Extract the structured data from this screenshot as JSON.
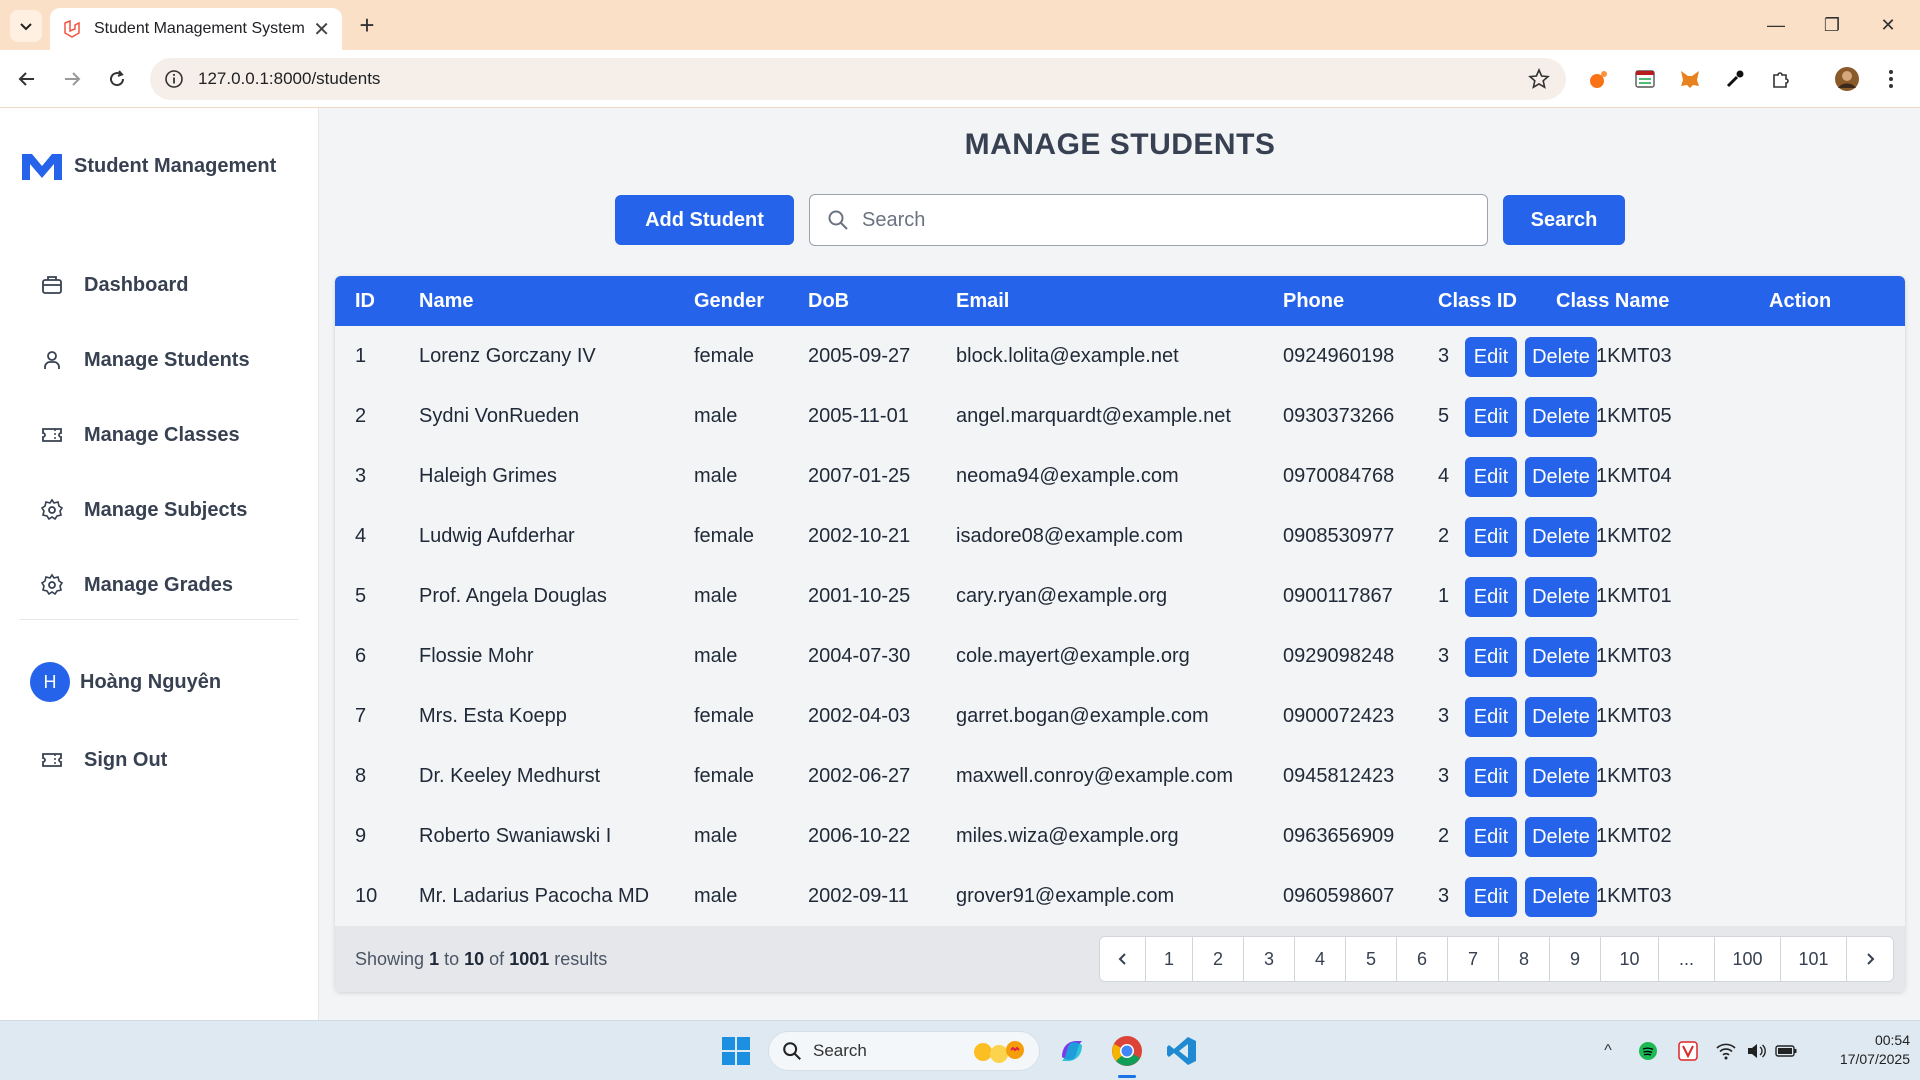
{
  "browser": {
    "tab_title": "Student Management System",
    "url": "127.0.0.1:8000/students"
  },
  "sidebar": {
    "brand": "Student Management",
    "items": [
      {
        "label": "Dashboard",
        "icon": "briefcase-icon"
      },
      {
        "label": "Manage Students",
        "icon": "user-icon"
      },
      {
        "label": "Manage Classes",
        "icon": "ticket-icon"
      },
      {
        "label": "Manage Subjects",
        "icon": "gear-icon"
      },
      {
        "label": "Manage Grades",
        "icon": "gear-icon"
      }
    ],
    "user": {
      "initial": "H",
      "name": "Hoàng Nguyên"
    },
    "sign_out": "Sign Out"
  },
  "main": {
    "title": "MANAGE STUDENTS",
    "add_label": "Add Student",
    "search_placeholder": "Search",
    "search_label": "Search"
  },
  "table": {
    "headers": [
      "ID",
      "Name",
      "Gender",
      "DoB",
      "Email",
      "Phone",
      "Class ID",
      "Class Name",
      "Action"
    ],
    "rows": [
      {
        "id": "1",
        "name": "Lorenz Gorczany IV",
        "gender": "female",
        "dob": "2005-09-27",
        "email": "block.lolita@example.net",
        "phone": "0924960198",
        "class_id": "3",
        "class_name": "DH21KMT03"
      },
      {
        "id": "2",
        "name": "Sydni VonRueden",
        "gender": "male",
        "dob": "2005-11-01",
        "email": "angel.marquardt@example.net",
        "phone": "0930373266",
        "class_id": "5",
        "class_name": "DH21KMT05"
      },
      {
        "id": "3",
        "name": "Haleigh Grimes",
        "gender": "male",
        "dob": "2007-01-25",
        "email": "neoma94@example.com",
        "phone": "0970084768",
        "class_id": "4",
        "class_name": "DH21KMT04"
      },
      {
        "id": "4",
        "name": "Ludwig Aufderhar",
        "gender": "female",
        "dob": "2002-10-21",
        "email": "isadore08@example.com",
        "phone": "0908530977",
        "class_id": "2",
        "class_name": "DH21KMT02"
      },
      {
        "id": "5",
        "name": "Prof. Angela Douglas",
        "gender": "male",
        "dob": "2001-10-25",
        "email": "cary.ryan@example.org",
        "phone": "0900117867",
        "class_id": "1",
        "class_name": "DH21KMT01"
      },
      {
        "id": "6",
        "name": "Flossie Mohr",
        "gender": "male",
        "dob": "2004-07-30",
        "email": "cole.mayert@example.org",
        "phone": "0929098248",
        "class_id": "3",
        "class_name": "DH21KMT03"
      },
      {
        "id": "7",
        "name": "Mrs. Esta Koepp",
        "gender": "female",
        "dob": "2002-04-03",
        "email": "garret.bogan@example.com",
        "phone": "0900072423",
        "class_id": "3",
        "class_name": "DH21KMT03"
      },
      {
        "id": "8",
        "name": "Dr. Keeley Medhurst",
        "gender": "female",
        "dob": "2002-06-27",
        "email": "maxwell.conroy@example.com",
        "phone": "0945812423",
        "class_id": "3",
        "class_name": "DH21KMT03"
      },
      {
        "id": "9",
        "name": "Roberto Swaniawski I",
        "gender": "male",
        "dob": "2006-10-22",
        "email": "miles.wiza@example.org",
        "phone": "0963656909",
        "class_id": "2",
        "class_name": "DH21KMT02"
      },
      {
        "id": "10",
        "name": "Mr. Ladarius Pacocha MD",
        "gender": "male",
        "dob": "2002-09-11",
        "email": "grover91@example.com",
        "phone": "0960598607",
        "class_id": "3",
        "class_name": "DH21KMT03"
      }
    ],
    "edit_label": "Edit",
    "delete_label": "Delete"
  },
  "pagination": {
    "showing_prefix": "Showing",
    "from": "1",
    "to_word": "to",
    "to": "10",
    "of_word": "of",
    "total": "1001",
    "results_word": "results",
    "pages": [
      "1",
      "2",
      "3",
      "4",
      "5",
      "6",
      "7",
      "8",
      "9",
      "10",
      "...",
      "100",
      "101"
    ]
  },
  "taskbar": {
    "search_label": "Search",
    "time": "00:54",
    "date": "17/07/2025"
  },
  "colors": {
    "accent": "#2563eb",
    "page_bg": "#f3f4f6",
    "tab_strip": "#fbe0c8"
  }
}
